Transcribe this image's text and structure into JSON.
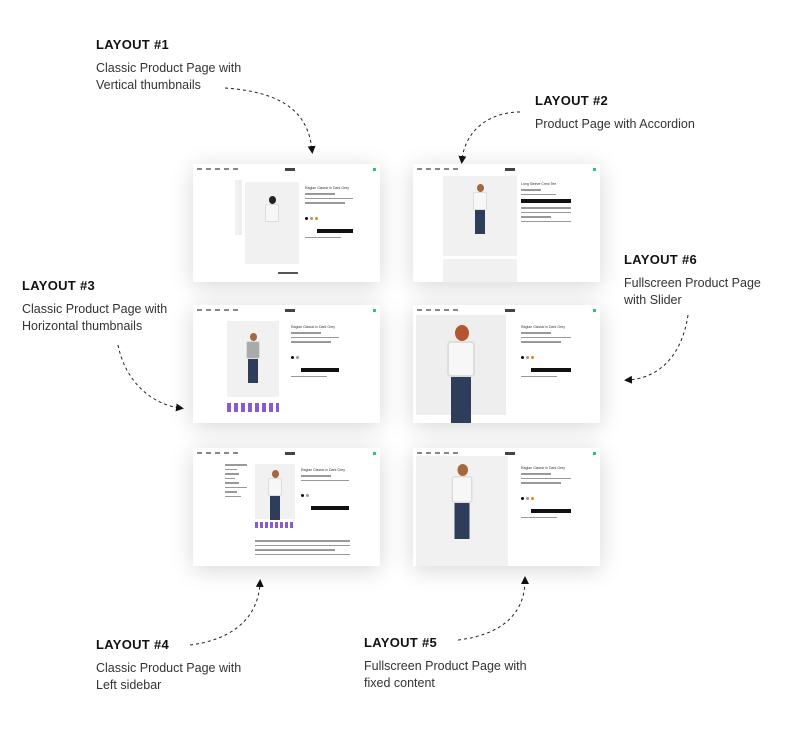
{
  "layouts": [
    {
      "title": "LAYOUT #1",
      "line1": "Classic Product Page with",
      "line2": "Vertical thumbnails"
    },
    {
      "title": "LAYOUT #2",
      "line1": "Product Page with Accordion",
      "line2": ""
    },
    {
      "title": "LAYOUT #3",
      "line1": "Classic Product Page with",
      "line2": "Horizontal thumbnails"
    },
    {
      "title": "LAYOUT #6",
      "line1": "Fullscreen Product Page",
      "line2": "with Slider"
    },
    {
      "title": "LAYOUT #4",
      "line1": "Classic Product Page with",
      "line2": "Left sidebar"
    },
    {
      "title": "LAYOUT #5",
      "line1": "Fullscreen Product Page with",
      "line2": "fixed content"
    }
  ],
  "previews": {
    "product_title": "Raglan Classic in Dark Grey",
    "product_title_2": "Long Sleeve Crew Tee",
    "colors": {
      "black": "#111111",
      "orange": "#e08a00",
      "accent": "#22cc77"
    }
  }
}
